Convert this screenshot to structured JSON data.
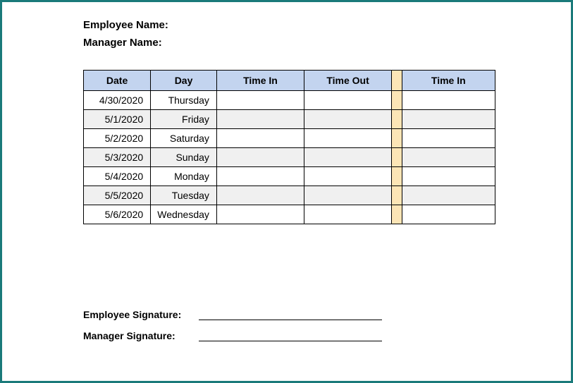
{
  "fields": {
    "employee_name_label": "Employee Name:",
    "manager_name_label": "Manager Name:",
    "employee_signature_label": "Employee Signature:",
    "manager_signature_label": "Manager Signature:"
  },
  "table": {
    "headers": {
      "date": "Date",
      "day": "Day",
      "time_in": "Time In",
      "time_out": "Time Out",
      "time_in2": "Time In"
    },
    "rows": [
      {
        "date": "4/30/2020",
        "day": "Thursday",
        "time_in": "",
        "time_out": "",
        "time_in2": "",
        "alt": false
      },
      {
        "date": "5/1/2020",
        "day": "Friday",
        "time_in": "",
        "time_out": "",
        "time_in2": "",
        "alt": true
      },
      {
        "date": "5/2/2020",
        "day": "Saturday",
        "time_in": "",
        "time_out": "",
        "time_in2": "",
        "alt": false
      },
      {
        "date": "5/3/2020",
        "day": "Sunday",
        "time_in": "",
        "time_out": "",
        "time_in2": "",
        "alt": true
      },
      {
        "date": "5/4/2020",
        "day": "Monday",
        "time_in": "",
        "time_out": "",
        "time_in2": "",
        "alt": false
      },
      {
        "date": "5/5/2020",
        "day": "Tuesday",
        "time_in": "",
        "time_out": "",
        "time_in2": "",
        "alt": true
      },
      {
        "date": "5/6/2020",
        "day": "Wednesday",
        "time_in": "",
        "time_out": "",
        "time_in2": "",
        "alt": false
      }
    ]
  }
}
